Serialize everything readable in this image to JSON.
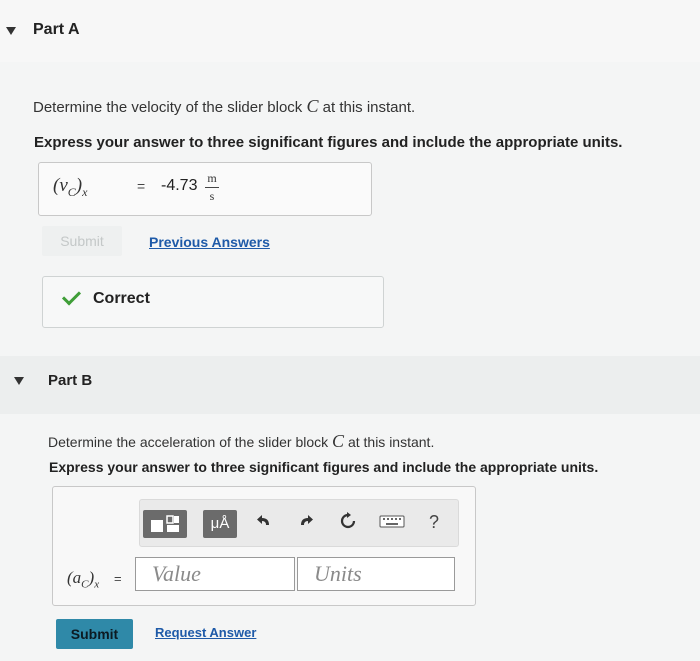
{
  "partA": {
    "title": "Part A",
    "question": "Determine the velocity of the slider block",
    "question_var": "C",
    "question_end": "at this instant.",
    "instruction": "Express your answer to three significant figures and include the appropriate units.",
    "answer": {
      "label": "(vC)x",
      "equals": "=",
      "value": "-4.73",
      "unit_num": "m",
      "unit_den": "s"
    },
    "submit_label": "Submit",
    "previous_answers_label": "Previous Answers",
    "feedback": "Correct"
  },
  "partB": {
    "title": "Part B",
    "question": "Determine the acceleration of the slider block",
    "question_var": "C",
    "question_end": "at this instant.",
    "instruction": "Express your answer to three significant figures and include the appropriate units.",
    "answer_label": "(aC)x",
    "equals": "=",
    "value_placeholder": "Value",
    "units_placeholder": "Units",
    "toolbar": {
      "mu_label": "μÅ",
      "help_label": "?"
    },
    "submit_label": "Submit",
    "request_answer_label": "Request Answer"
  },
  "colors": {
    "accent": "#2f89a8",
    "link": "#1e5aa8",
    "correct": "#3f9e38"
  }
}
